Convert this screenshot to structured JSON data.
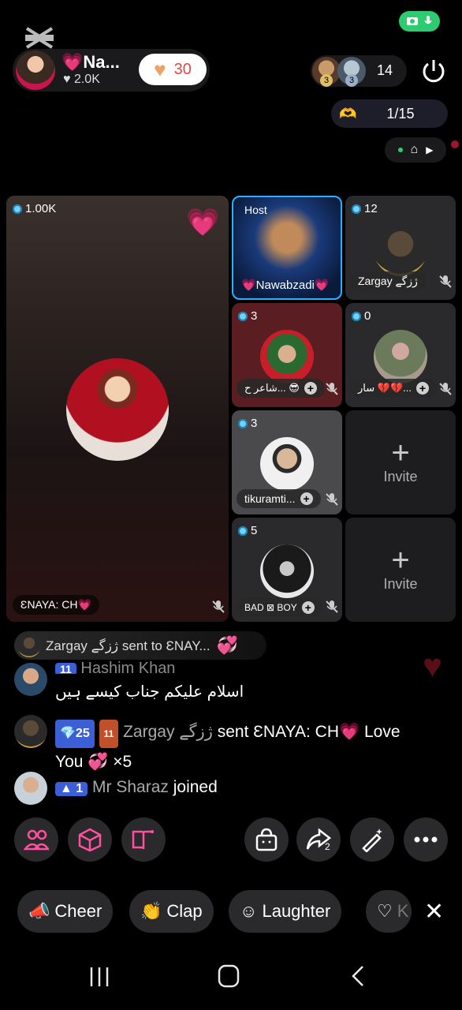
{
  "status": {
    "camera_mic": "recording"
  },
  "host": {
    "name": "💗Na...",
    "likes": "♥ 2.0K",
    "gift_count": "30"
  },
  "viewers": {
    "avatar1_level": "3",
    "avatar2_level": "3",
    "count": "14"
  },
  "rank": {
    "value": "1/15"
  },
  "tiles": {
    "main": {
      "coins": "1.00K",
      "name": "ƐNAYA: CH💗"
    },
    "host_tile": {
      "label": "Host",
      "name": "💗Nawabzadi💗"
    },
    "t2": {
      "coins": "12",
      "name": "Zargay  ژزگے"
    },
    "t3": {
      "coins": "3",
      "name": "شاعر ح... 😎"
    },
    "t4": {
      "coins": "0",
      "name": "سار 💔💔..."
    },
    "t5": {
      "coins": "3",
      "name": "tikuramti..."
    },
    "t6": {
      "label": "Invite"
    },
    "t7": {
      "coins": "5",
      "name": "BAD ⊠ BOY"
    },
    "t8": {
      "label": "Invite"
    }
  },
  "gift_banner": {
    "text": "Zargay  ژزگے  sent to ƐNAY..."
  },
  "chat": {
    "msg1_name": "Hashim Khan",
    "msg1_level": "11",
    "msg1_text": "اسلام علیکم جناب کیسے ہیں",
    "msg2_level": "25",
    "msg2_badge": "11",
    "msg2_name": "Zargay  ژزگے",
    "msg2_text1": " sent ƐNAYA: CH💗 Love",
    "msg2_text2": "You 💞 ×5",
    "msg3_level": "1",
    "msg3_name": "Mr Sharaz",
    "msg3_text": " joined"
  },
  "reactions": {
    "cheer": "Cheer",
    "clap": "Clap",
    "laughter": "Laughter",
    "fourth": "K"
  },
  "share_count": "2",
  "colors": {
    "accent": "#ff3b8b",
    "badge_blue": "#3d5fd6",
    "green": "#2ecc71"
  }
}
